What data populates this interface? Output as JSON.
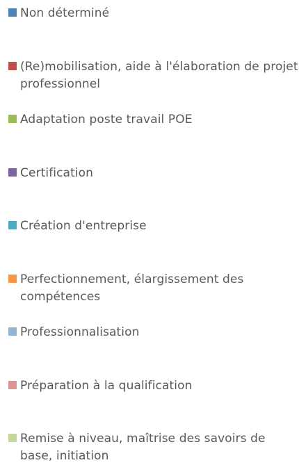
{
  "chart_data": {
    "type": "legend",
    "legend": [
      {
        "label": "Non déterminé",
        "color": "#4f81bd"
      },
      {
        "label": "(Re)mobilisation, aide à l'élaboration de projet professionnel",
        "color": "#c0504d"
      },
      {
        "label": "Adaptation poste travail POE",
        "color": "#9bbb59"
      },
      {
        "label": "Certification",
        "color": "#8064a2"
      },
      {
        "label": "Création d'entreprise",
        "color": "#4bacc6"
      },
      {
        "label": "Perfectionnement, élargissement des compétences",
        "color": "#f79646"
      },
      {
        "label": "Professionnalisation",
        "color": "#95b3d7"
      },
      {
        "label": "Préparation à la qualification",
        "color": "#d99694"
      },
      {
        "label": "Remise à niveau, maîtrise des savoirs de base, initiation",
        "color": "#c3d69b"
      }
    ]
  }
}
